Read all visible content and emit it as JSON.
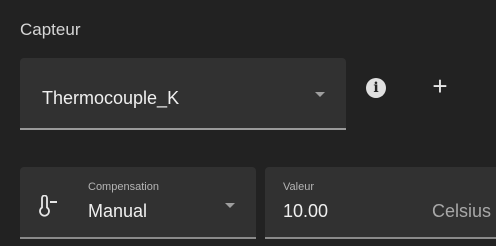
{
  "section": {
    "title": "Capteur"
  },
  "sensor": {
    "value": "Thermocouple_K"
  },
  "actions": {
    "info_icon": "info-circle",
    "add_label": "+"
  },
  "compensation": {
    "label": "Compensation",
    "value": "Manual",
    "icon": "thermometer-minus"
  },
  "value_field": {
    "label": "Valeur",
    "value": "10.00",
    "unit": "Celsius"
  }
}
